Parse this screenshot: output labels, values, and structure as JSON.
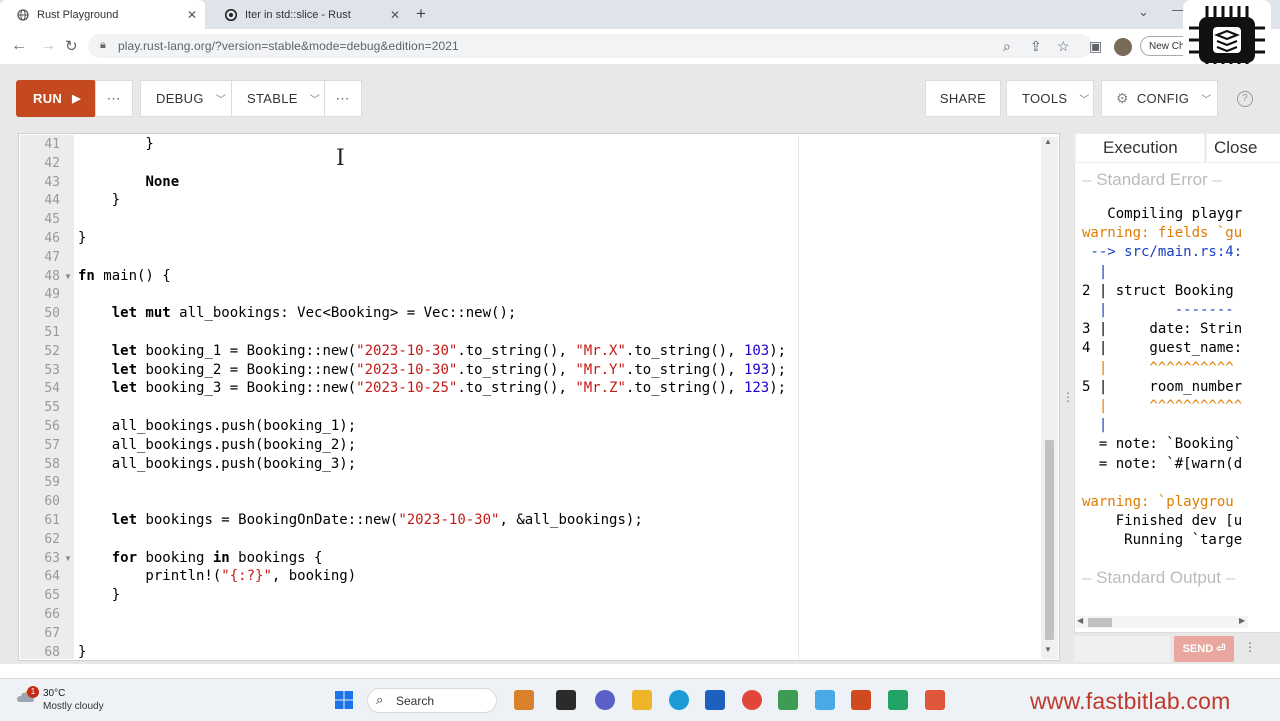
{
  "browser": {
    "tabs": [
      {
        "title": "Rust Playground",
        "active": true
      },
      {
        "title": "Iter in std::slice - Rust",
        "active": false
      }
    ],
    "url": "play.rust-lang.org/?version=stable&mode=debug&edition=2021",
    "new_chrome_label": "New Ch"
  },
  "toolbar": {
    "run": "RUN",
    "debug": "DEBUG",
    "stable": "STABLE",
    "share": "SHARE",
    "tools": "TOOLS",
    "config": "CONFIG",
    "help": "?"
  },
  "editor": {
    "lines": [
      {
        "n": "41",
        "html": "        }"
      },
      {
        "n": "42",
        "html": ""
      },
      {
        "n": "43",
        "html": "        <span class=\"kw\">None</span>"
      },
      {
        "n": "44",
        "html": "    }"
      },
      {
        "n": "45",
        "html": ""
      },
      {
        "n": "46",
        "html": "}"
      },
      {
        "n": "47",
        "html": ""
      },
      {
        "n": "48",
        "html": "<span class=\"kw\">fn</span> main() {",
        "fold": true
      },
      {
        "n": "49",
        "html": ""
      },
      {
        "n": "50",
        "html": "    <span class=\"kw\">let mut</span> all_bookings: Vec&lt;Booking&gt; = Vec::new();"
      },
      {
        "n": "51",
        "html": ""
      },
      {
        "n": "52",
        "html": "    <span class=\"kw\">let</span> booking_1 = Booking::new(<span class=\"str\">\"2023-10-30\"</span>.to_string(), <span class=\"str\">\"Mr.X\"</span>.to_string(), <span class=\"num\">103</span>);"
      },
      {
        "n": "53",
        "html": "    <span class=\"kw\">let</span> booking_2 = Booking::new(<span class=\"str\">\"2023-10-30\"</span>.to_string(), <span class=\"str\">\"Mr.Y\"</span>.to_string(), <span class=\"num\">193</span>);"
      },
      {
        "n": "54",
        "html": "    <span class=\"kw\">let</span> booking_3 = Booking::new(<span class=\"str\">\"2023-10-25\"</span>.to_string(), <span class=\"str\">\"Mr.Z\"</span>.to_string(), <span class=\"num\">123</span>);"
      },
      {
        "n": "55",
        "html": ""
      },
      {
        "n": "56",
        "html": "    all_bookings.push(booking_1);"
      },
      {
        "n": "57",
        "html": "    all_bookings.push(booking_2);"
      },
      {
        "n": "58",
        "html": "    all_bookings.push(booking_3);"
      },
      {
        "n": "59",
        "html": ""
      },
      {
        "n": "60",
        "html": ""
      },
      {
        "n": "61",
        "html": "    <span class=\"kw\">let</span> bookings = BookingOnDate::new(<span class=\"str\">\"2023-10-30\"</span>, &amp;all_bookings);"
      },
      {
        "n": "62",
        "html": ""
      },
      {
        "n": "63",
        "html": "    <span class=\"kw\">for</span> booking <span class=\"kw\">in</span> bookings {",
        "fold": true
      },
      {
        "n": "64",
        "html": "        println!(<span class=\"str\">\"{:?}\"</span>, booking)"
      },
      {
        "n": "65",
        "html": "    }"
      },
      {
        "n": "66",
        "html": ""
      },
      {
        "n": "67",
        "html": ""
      },
      {
        "n": "68",
        "html": "}"
      }
    ]
  },
  "output": {
    "tab_execution": "Execution",
    "tab_close": "Close",
    "stderr_header": "Standard Error",
    "stdout_header": "Standard Output",
    "lines": [
      {
        "cls": "",
        "text": "   Compiling playgr"
      },
      {
        "cls": "warn",
        "text": "warning: fields `gu"
      },
      {
        "cls": "blue",
        "text": " --> src/main.rs:4:"
      },
      {
        "cls": "blue",
        "text": "  |"
      },
      {
        "cls": "",
        "text": "2 | struct Booking"
      },
      {
        "cls": "blue",
        "text": "  |        -------"
      },
      {
        "cls": "",
        "text": "3 |     date: Strin"
      },
      {
        "cls": "",
        "text": "4 |     guest_name:"
      },
      {
        "cls": "warn",
        "text": "  |     ^^^^^^^^^^"
      },
      {
        "cls": "",
        "text": "5 |     room_number"
      },
      {
        "cls": "warn",
        "text": "  |     ^^^^^^^^^^^"
      },
      {
        "cls": "blue",
        "text": "  |"
      },
      {
        "cls": "",
        "text": "  = note: `Booking`"
      },
      {
        "cls": "",
        "text": "  = note: `#[warn(d"
      },
      {
        "cls": "",
        "text": ""
      },
      {
        "cls": "warn",
        "text": "warning: `playgrou"
      },
      {
        "cls": "",
        "text": "    Finished dev [u"
      },
      {
        "cls": "",
        "text": "     Running `targe"
      }
    ],
    "send": "SEND"
  },
  "taskbar": {
    "weather_badge": "1",
    "weather_temp": "30°C",
    "weather_desc": "Mostly cloudy",
    "search": "Search",
    "watermark": "www.fastbitlab.com"
  },
  "colors": {
    "run_button": "#c4491f",
    "accent_warn": "#e07b00",
    "string": "#c41a16",
    "number": "#1c00cf",
    "watermark": "#c0392b"
  }
}
